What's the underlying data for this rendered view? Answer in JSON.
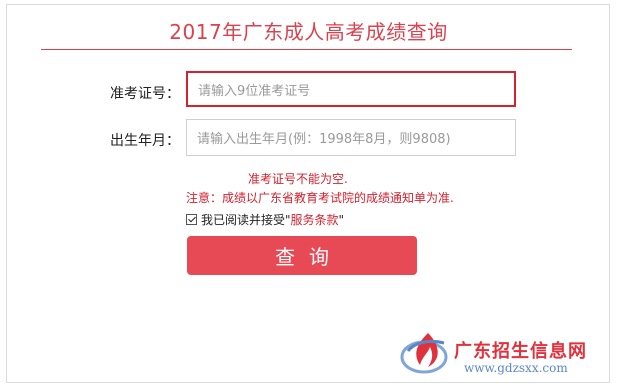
{
  "page": {
    "title": "2017年广东成人高考成绩查询"
  },
  "form": {
    "exam_no_label": "准考证号：",
    "exam_no_placeholder": "请输入9位准考证号",
    "birth_label": "出生年月：",
    "birth_placeholder": "请输入出生年月(例：1998年8月，则9808)",
    "error_text": "准考证号不能为空.",
    "notice_text": "注意：成绩以广东省教育考试院的成绩通知单为准.",
    "agree_text": "我已阅读并接受\"",
    "agree_link": "服务条款",
    "agree_end": "\"",
    "agree_checked": true,
    "submit_label": "查询"
  },
  "watermark": {
    "site_name": "广东招生信息网",
    "site_url": "www.gdzsxx.com",
    "icon": "flame-logo-icon"
  },
  "colors": {
    "accent": "#d9434f",
    "error": "#d4222f",
    "button": "#e84a55"
  }
}
